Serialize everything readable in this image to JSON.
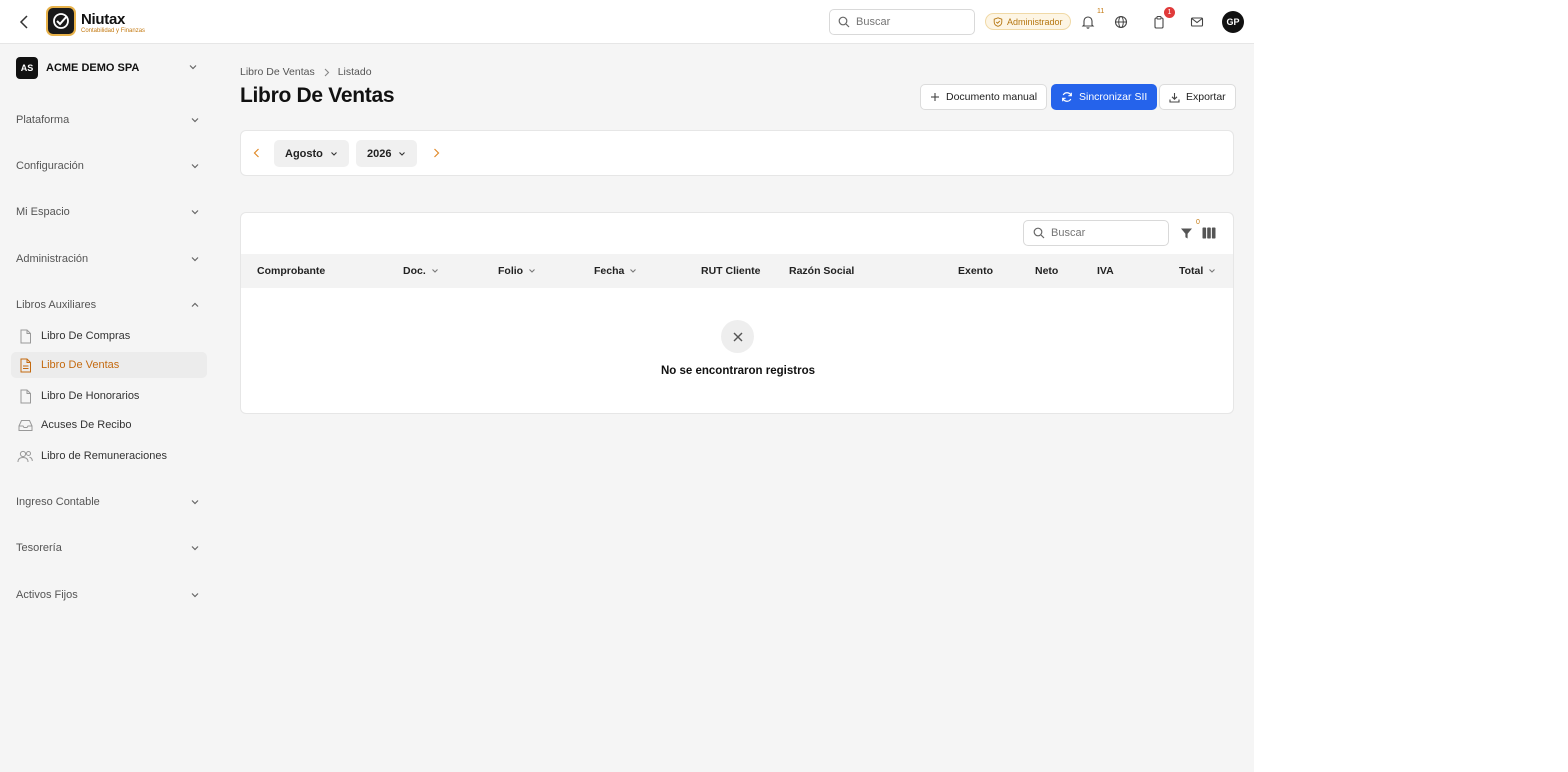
{
  "header": {
    "brand_name": "Niutax",
    "brand_tagline": "Contabilidad y Finanzas",
    "search_placeholder": "Buscar",
    "role_badge": "Administrador",
    "notifications_count": "11",
    "cart_count": "1",
    "avatar_initials": "GP"
  },
  "sidebar": {
    "company_initials": "AS",
    "company_name": "ACME DEMO SPA",
    "groups": [
      {
        "label": "Plataforma"
      },
      {
        "label": "Configuración"
      },
      {
        "label": "Mi Espacio"
      },
      {
        "label": "Administración"
      },
      {
        "label": "Libros Auxiliares"
      },
      {
        "label": "Ingreso Contable"
      },
      {
        "label": "Tesorería"
      },
      {
        "label": "Activos Fijos"
      }
    ],
    "items": [
      {
        "label": "Libro De Compras",
        "icon": "document-icon"
      },
      {
        "label": "Libro De Ventas",
        "icon": "document-icon",
        "active": true
      },
      {
        "label": "Libro De Honorarios",
        "icon": "document-icon"
      },
      {
        "label": "Acuses De Recibo",
        "icon": "inbox-icon"
      },
      {
        "label": "Libro de Remuneraciones",
        "icon": "users-icon"
      }
    ]
  },
  "breadcrumb": [
    "Libro De Ventas",
    "Listado"
  ],
  "page_title": "Libro De Ventas",
  "actions": {
    "manual": "Documento manual",
    "sync": "Sincronizar SII",
    "export": "Exportar"
  },
  "period": {
    "month": "Agosto",
    "year": "2026"
  },
  "table": {
    "search_placeholder": "Buscar",
    "filter_count": "0",
    "columns": [
      "Comprobante",
      "Doc.",
      "Folio",
      "Fecha",
      "RUT Cliente",
      "Razón Social",
      "Exento",
      "Neto",
      "IVA",
      "Total"
    ],
    "empty_message": "No se encontraron registros"
  },
  "colors": {
    "accent": "#c46a10",
    "primary": "#2563eb",
    "badge_red": "#e03a3a"
  }
}
